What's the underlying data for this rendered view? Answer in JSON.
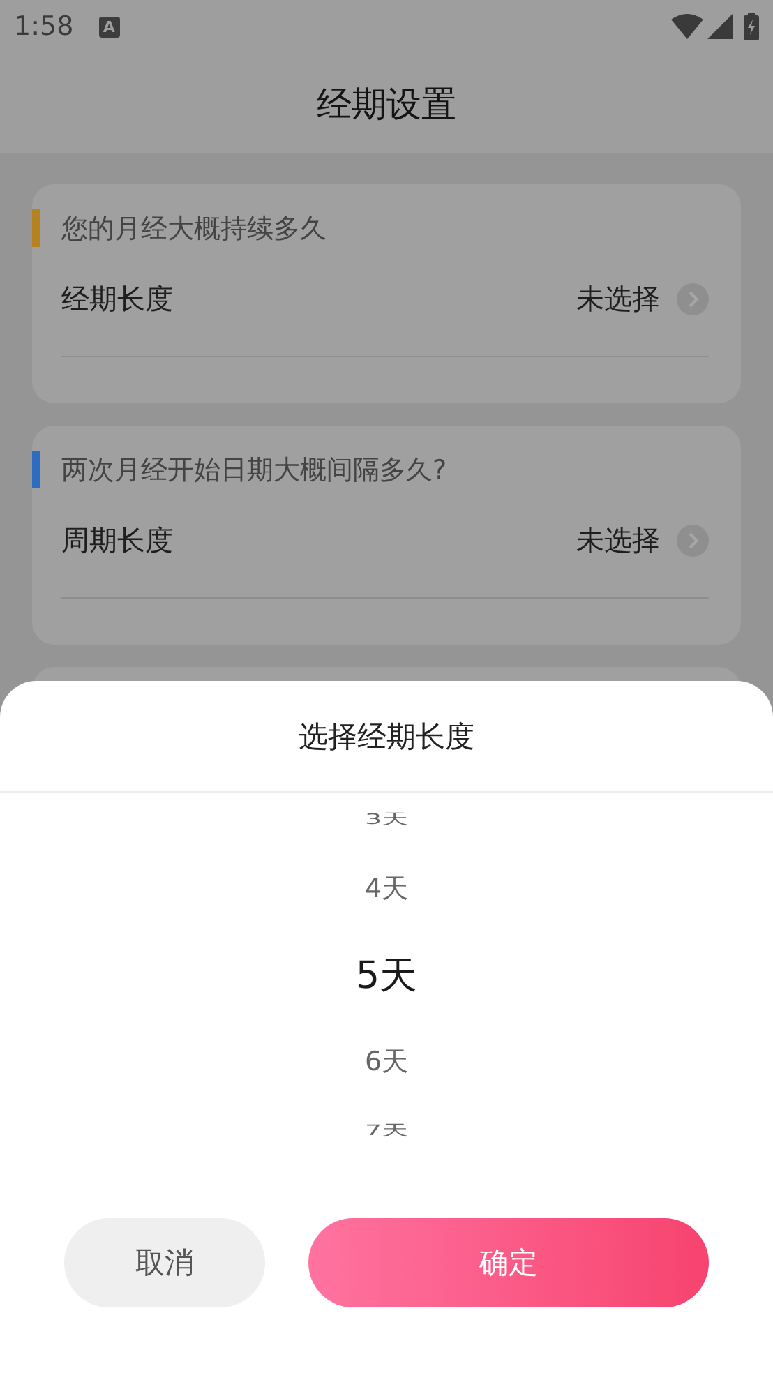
{
  "status_bar": {
    "time": "1:58",
    "notification": "A"
  },
  "header": {
    "title": "经期设置"
  },
  "cards": [
    {
      "question": "您的月经大概持续多久",
      "color": "#b5821f",
      "label": "经期长度",
      "value": "未选择"
    },
    {
      "question": "两次月经开始日期大概间隔多久?",
      "color": "#2d6cc0",
      "label": "周期长度",
      "value": "未选择"
    }
  ],
  "sheet": {
    "title": "选择经期长度",
    "options": [
      {
        "label": "3天",
        "selected": false
      },
      {
        "label": "4天",
        "selected": false
      },
      {
        "label": "5天",
        "selected": true
      },
      {
        "label": "6天",
        "selected": false
      },
      {
        "label": "7天",
        "selected": false
      }
    ],
    "cancel": "取消",
    "confirm": "确定"
  }
}
